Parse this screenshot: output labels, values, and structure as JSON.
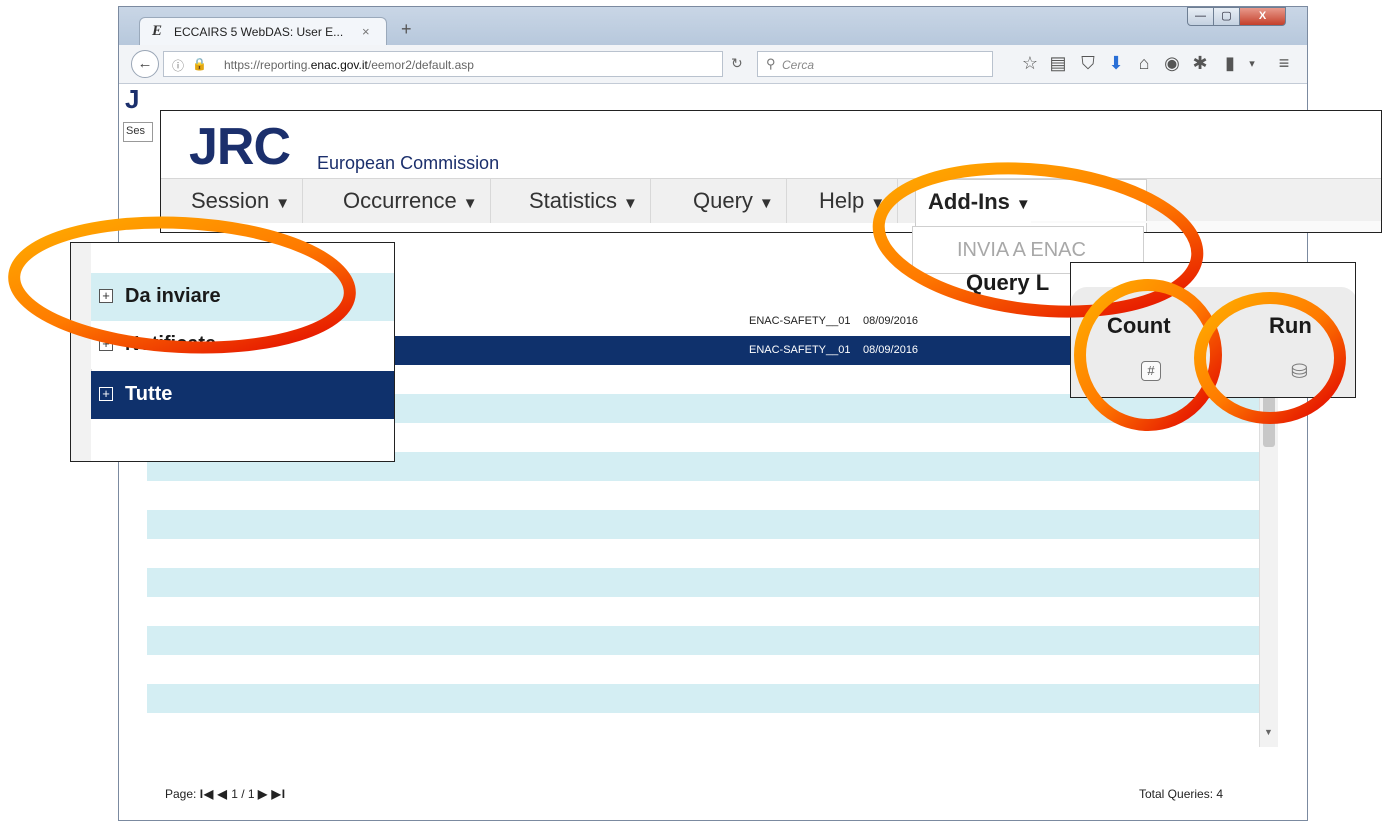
{
  "browser": {
    "tab_title": "ECCAIRS 5 WebDAS: User E...",
    "tab_favicon": "E",
    "tab_close": "×",
    "new_tab": "+",
    "url": {
      "prefix": "https://reporting.",
      "domain": "enac.gov.it",
      "path": "/eemor2/default.asp"
    },
    "search_placeholder": "Cerca",
    "window_buttons": {
      "minimize": "—",
      "maximize": "▢",
      "close": "X"
    },
    "toolbar_icons": [
      "star-icon",
      "reading-list-icon",
      "pocket-icon",
      "download-icon",
      "home-icon",
      "chat-icon",
      "extension-icon",
      "clipboard-icon",
      "overflow-icon",
      "hamburger-menu-icon"
    ]
  },
  "page": {
    "logo_small": "J",
    "session_short": "Ses"
  },
  "header": {
    "logo": "JRC",
    "subtitle": "European Commission"
  },
  "menu": {
    "items": [
      "Session",
      "Occurrence",
      "Statistics",
      "Query",
      "Help",
      "Add-Ins"
    ],
    "open_item": "Add-Ins",
    "dropdown_item": "INVIA A ENAC"
  },
  "query_list": {
    "title": "Query L"
  },
  "folders": [
    {
      "label": "Da inviare",
      "state": "plus"
    },
    {
      "label": "Notificate",
      "state": "plus"
    },
    {
      "label": "Tutte",
      "state": "plus",
      "selected": true
    }
  ],
  "table": {
    "rows": [
      {
        "owner": "ENAC-SAFETY__01",
        "date": "08/09/2016"
      },
      {
        "owner": "ENAC-SAFETY__01",
        "date": "08/09/2016",
        "selected": true
      }
    ],
    "empty_rows": 12
  },
  "columns": {
    "count": "Count",
    "run": "Run"
  },
  "footer": {
    "page_label": "Page:",
    "page_nav_first": "I◀",
    "page_nav_prev": "◀",
    "page_value": "1 / 1",
    "page_nav_next": "▶",
    "page_nav_last": "▶I",
    "total_label": "Total Queries: 4"
  },
  "colors": {
    "accent": "#0f316c",
    "row_alt": "#d4eef3",
    "highlight_oval_outer": "#ffa500",
    "highlight_oval_inner": "#e00000"
  }
}
